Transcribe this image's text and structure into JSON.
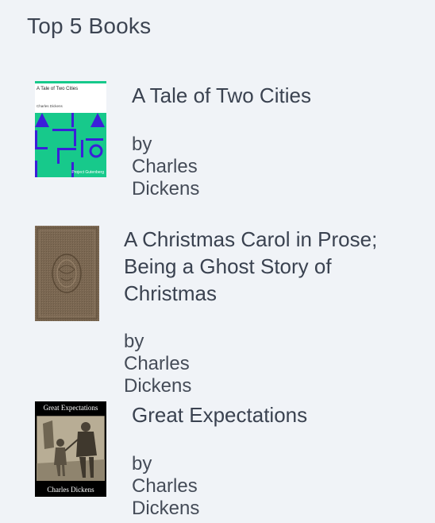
{
  "heading": "Top 5 Books",
  "books": [
    {
      "title": "A Tale of Two Cities",
      "author": "by Charles Dickens",
      "cover": {
        "title": "A Tale of Two Cities",
        "author": "Charles Dickens",
        "publisher": "Project Gutenberg",
        "accent": "#17c98b",
        "shape_color": "#3b1fd9"
      }
    },
    {
      "title": "A Christmas Carol in Prose; Being a Ghost Story of Christmas",
      "author": "by Charles Dickens",
      "cover": {
        "color": "#7a6752"
      }
    },
    {
      "title": "Great Expectations",
      "author": "by Charles Dickens",
      "cover": {
        "title": "Great Expectations",
        "author": "Charles Dickens"
      }
    }
  ],
  "colors": {
    "background": "#f0f3f7",
    "text": "#3a4250"
  }
}
